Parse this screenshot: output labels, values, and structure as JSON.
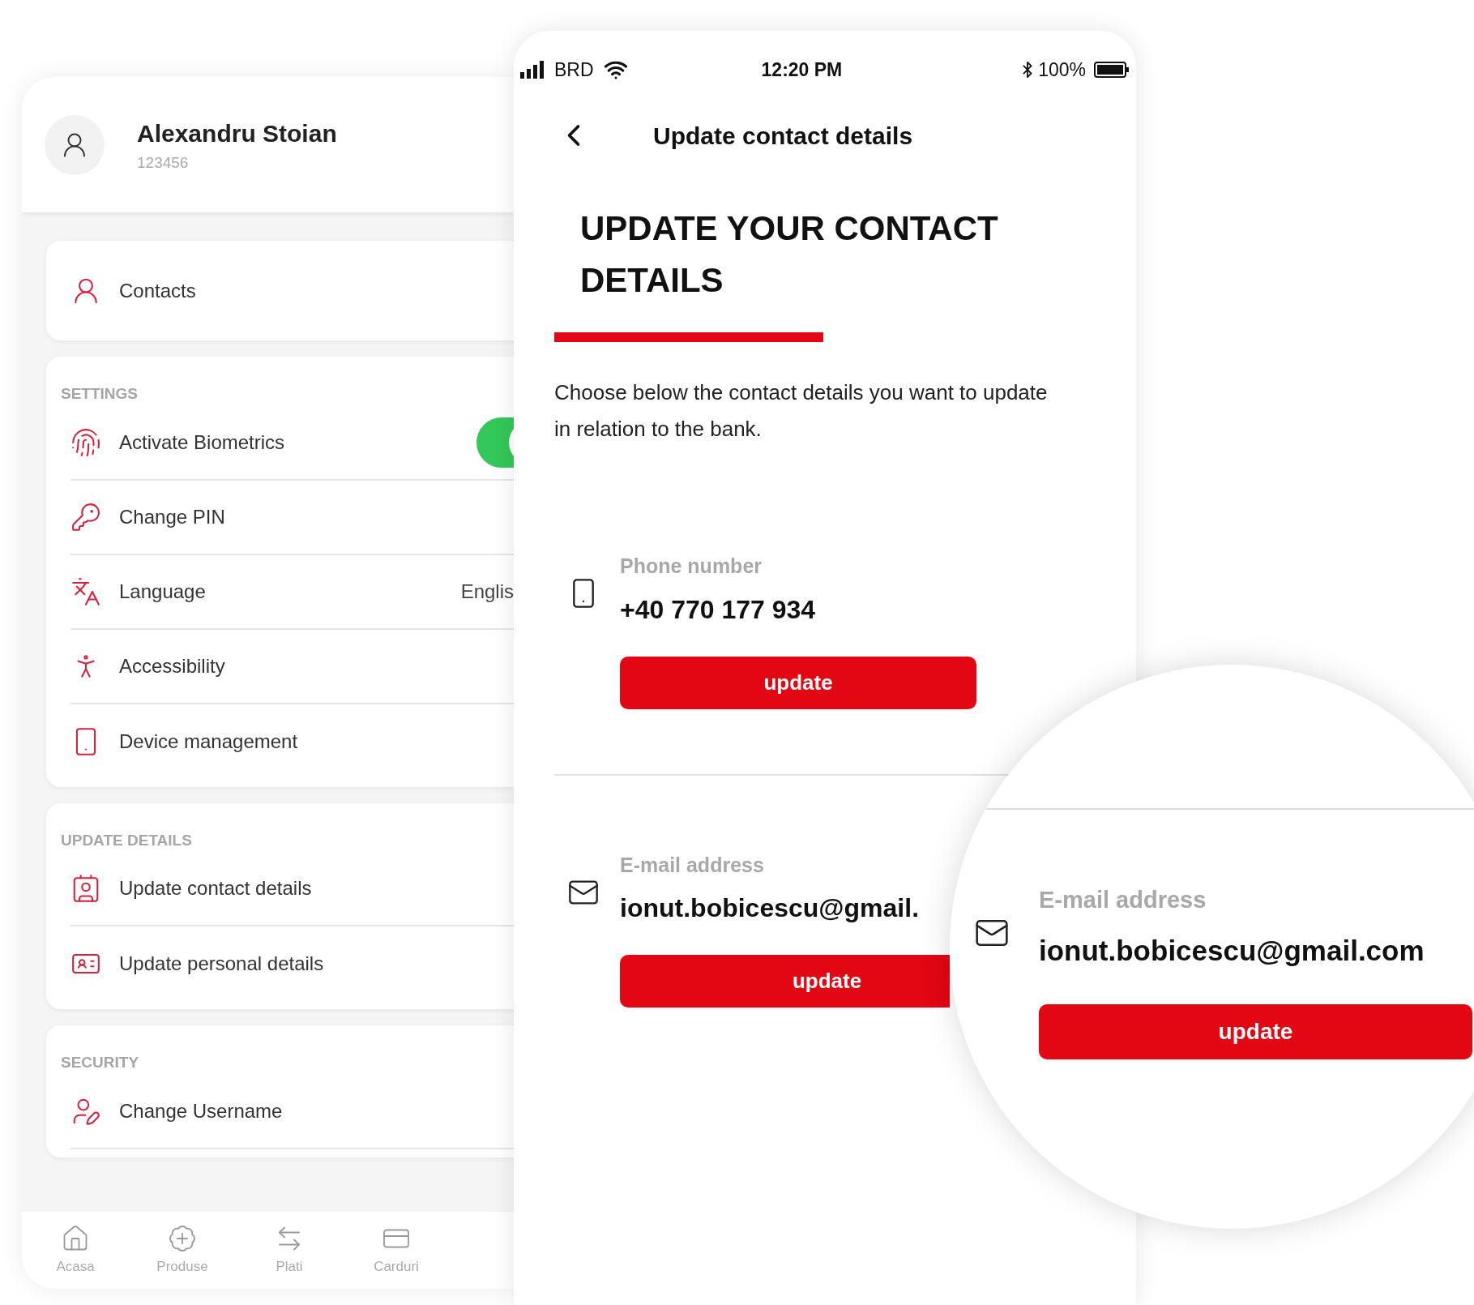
{
  "profile_screen": {
    "user": {
      "name": "Alexandru Stoian",
      "id": "123456"
    },
    "contacts_item": {
      "label": "Contacts"
    },
    "sections": [
      {
        "title": "SETTINGS",
        "items": [
          {
            "kind": "toggle",
            "label": "Activate Biometrics",
            "on": true
          },
          {
            "kind": "link",
            "label": "Change PIN"
          },
          {
            "kind": "value",
            "label": "Language",
            "value": "Englis"
          },
          {
            "kind": "link",
            "label": "Accessibility"
          },
          {
            "kind": "link",
            "label": "Device management"
          }
        ]
      },
      {
        "title": "UPDATE DETAILS",
        "items": [
          {
            "kind": "link",
            "label": "Update contact details"
          },
          {
            "kind": "link",
            "label": "Update personal details"
          }
        ]
      },
      {
        "title": "SECURITY",
        "items": [
          {
            "kind": "link",
            "label": "Change Username"
          }
        ]
      }
    ],
    "bottom_nav": [
      {
        "label": "Acasa"
      },
      {
        "label": "Produse"
      },
      {
        "label": "Plati"
      },
      {
        "label": "Carduri"
      }
    ]
  },
  "detail_screen": {
    "status_bar": {
      "carrier": "BRD",
      "time": "12:20 PM",
      "battery": "100%"
    },
    "title": "Update contact details",
    "heading": "UPDATE YOUR CONTACT DETAILS",
    "intro": "Choose below the contact details you want to update in relation to the bank.",
    "fields": [
      {
        "kind": "phone",
        "label": "Phone number",
        "value": "+40 770 177 934",
        "button": "update"
      },
      {
        "kind": "email",
        "label": "E-mail address",
        "value": "ionut.bobicescu@gmail.",
        "button": "update"
      }
    ]
  },
  "magnifier": {
    "label": "E-mail address",
    "value": "ionut.bobicescu@gmail.com",
    "button": "update"
  }
}
